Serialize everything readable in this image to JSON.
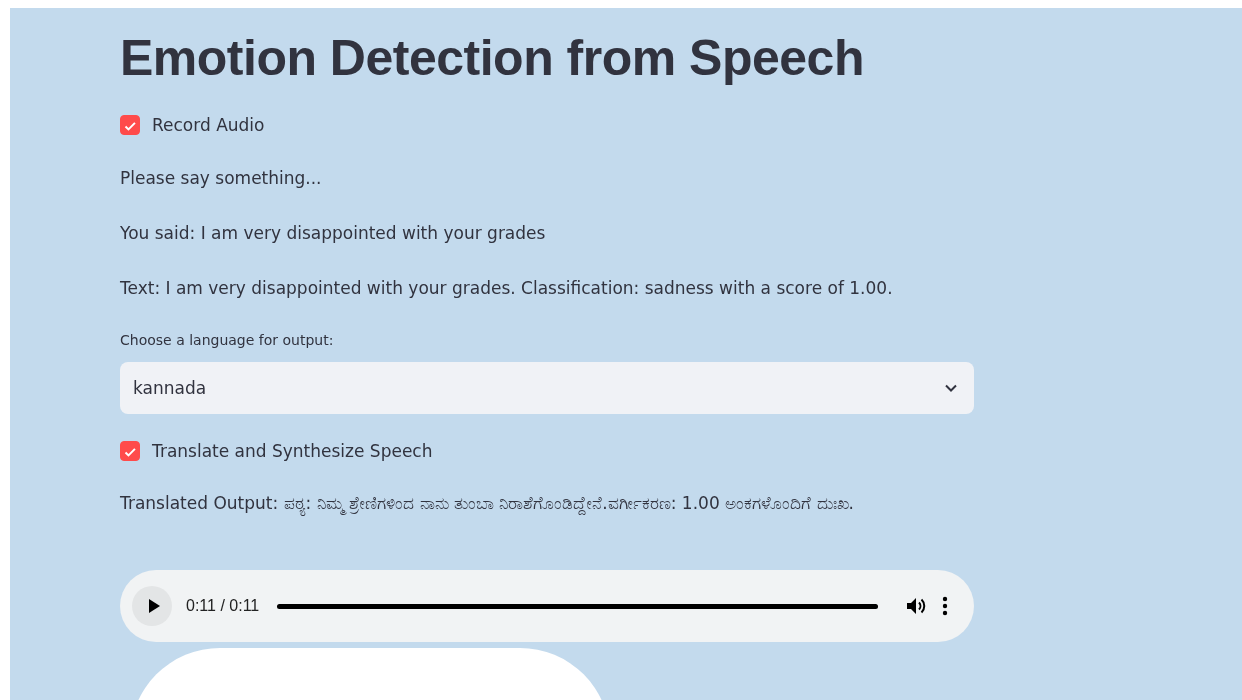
{
  "title": "Emotion Detection from Speech",
  "record_audio": {
    "label": "Record Audio",
    "checked": true
  },
  "messages": [
    "Please say something...",
    "You said: I am very disappointed with your grades",
    "Text: I am very disappointed with your grades. Classification: sadness with a score of 1.00."
  ],
  "language_select": {
    "label": "Choose a language for output:",
    "value": "kannada"
  },
  "translate": {
    "label": "Translate and Synthesize Speech",
    "checked": true
  },
  "translated_output": "Translated Output: ಪಠ್ಯ: ನಿಮ್ಮ ಶ್ರೇಣಿಗಳಿಂದ ನಾನು ತುಂಬಾ ನಿರಾಶೆಗೊಂಡಿದ್ದೇನೆ.ವರ್ಗೀಕರಣ: 1.00 ಅಂಕಗಳೊಂದಿಗೆ ದುಃಖ.",
  "audio_player": {
    "time": "0:11 / 0:11",
    "level": 1.0
  }
}
